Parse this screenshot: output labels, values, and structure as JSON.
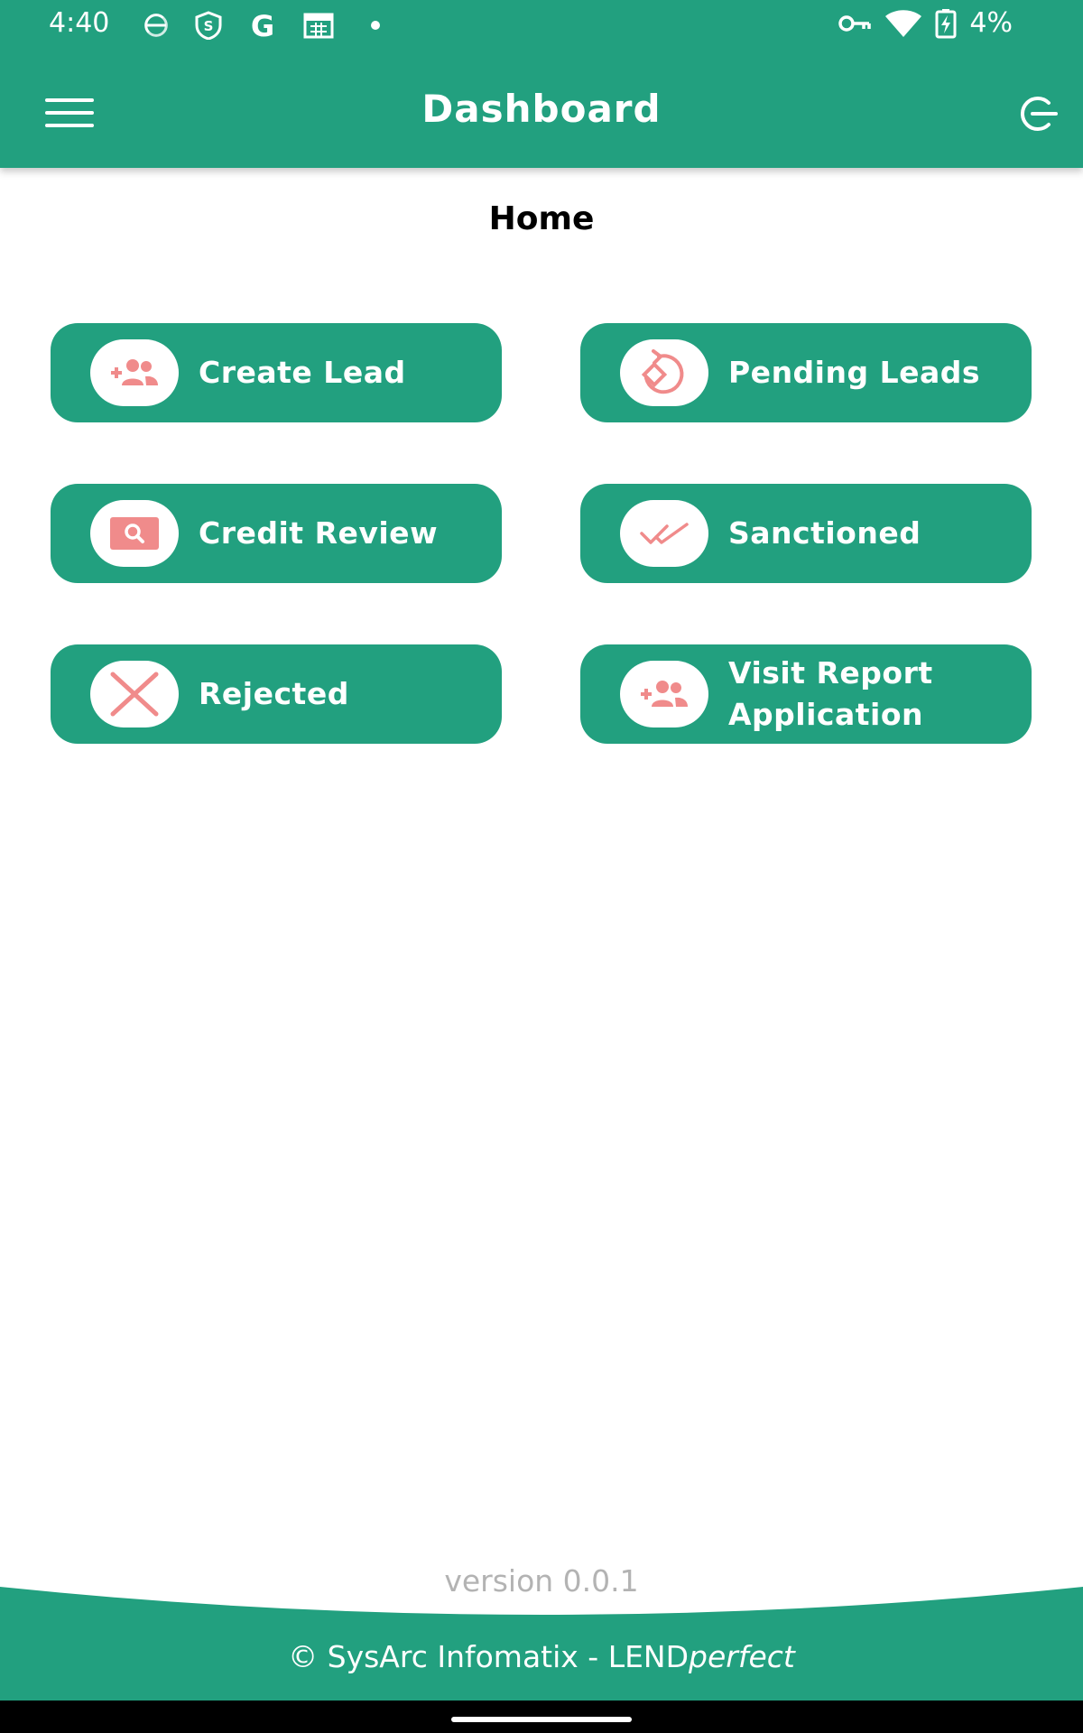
{
  "status_bar": {
    "time": "4:40",
    "battery": "4%",
    "icons": [
      "s-circle-icon",
      "shield-s-icon",
      "google-g-icon",
      "calendar-icon",
      "dot-icon",
      "vpn-key-icon",
      "wifi-icon",
      "battery-charging-icon"
    ]
  },
  "header": {
    "title": "Dashboard",
    "menu_icon": "hamburger-menu-icon",
    "logout_icon": "logout-icon"
  },
  "section_title": "Home",
  "tiles": [
    {
      "label": "Create Lead",
      "icon": "add-users-icon"
    },
    {
      "label": "Pending Leads",
      "icon": "pending-rotate-icon"
    },
    {
      "label": "Credit Review",
      "icon": "search-card-icon"
    },
    {
      "label": "Sanctioned",
      "icon": "double-check-icon"
    },
    {
      "label": "Rejected",
      "icon": "close-x-icon"
    },
    {
      "label": "Visit Report Application",
      "icon": "add-users-icon"
    }
  ],
  "version": "version 0.0.1",
  "footer": {
    "copyright": "© SysArc Infomatix - LEND",
    "brand_italic": "perfect"
  },
  "colors": {
    "primary": "#22a07f",
    "icon_accent": "#f08b8b",
    "version_text": "#b3b3b3"
  }
}
